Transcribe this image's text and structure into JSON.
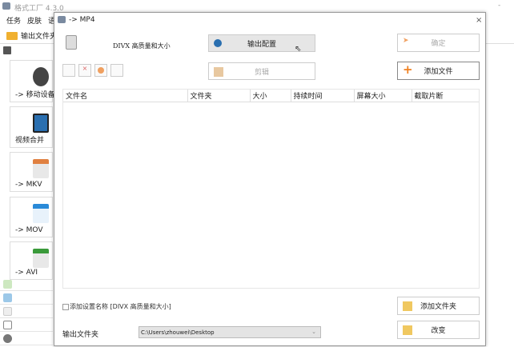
{
  "app": {
    "title": "格式工厂 4.3.0",
    "menu": [
      "任务",
      "皮肤",
      "语"
    ],
    "toolbar_output_folder": "输出文件夹"
  },
  "sidebar": {
    "tiles": [
      {
        "label": "-> 移动设备",
        "icon": "film-reel-icon"
      },
      {
        "label": "视频合并",
        "icon": "film-strip-icon"
      },
      {
        "label": "-> MKV",
        "icon": "mkv-file-icon"
      },
      {
        "label": "-> MOV",
        "icon": "mov-file-icon"
      },
      {
        "label": "-> AVI",
        "icon": "avi-file-icon"
      }
    ],
    "categories": [
      "music-icon",
      "picture-icon",
      "document-icon",
      "disc-icon",
      "tools-icon"
    ]
  },
  "dialog": {
    "title": "-> MP4",
    "profile": "DIVX 高质量和大小",
    "output_config": "输出配置",
    "ok": "确定",
    "clip": "剪辑",
    "add_file": "添加文件",
    "columns": [
      "文件名",
      "文件夹",
      "大小",
      "持续时间",
      "屏幕大小",
      "截取片断"
    ],
    "add_setting_name": "添加设置名称 [DIVX 高质量和大小]",
    "add_folder": "添加文件夹",
    "output_folder_label": "输出文件夹",
    "output_folder_value": "C:\\Users\\zhouwei\\Desktop",
    "change": "改变"
  }
}
